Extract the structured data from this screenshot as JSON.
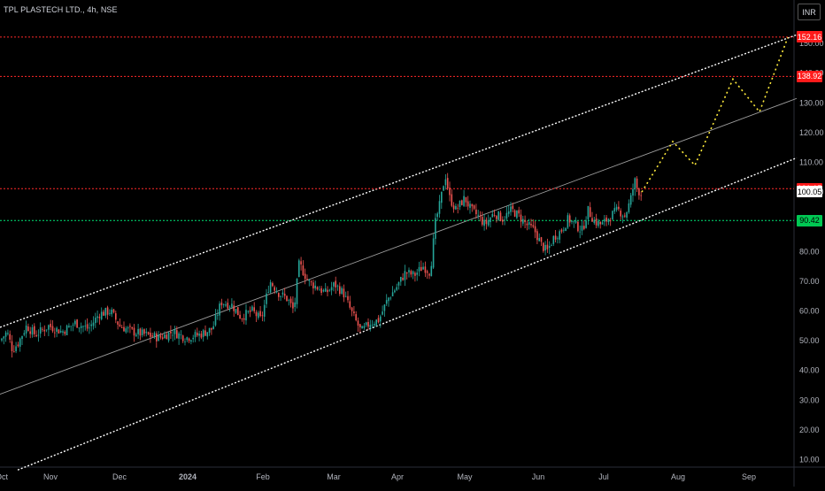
{
  "header": {
    "title": "TPL PLASTECH LTD., 4h, NSE",
    "currency_label": "INR"
  },
  "colors": {
    "background": "#000000",
    "up_candle": "#26a69a",
    "down_candle": "#ef5350",
    "resistance_line": "#ff2a2a",
    "support_line": "#00e676",
    "channel_line": "#ffffff",
    "mid_line": "#9e9e9e",
    "projection": "#ffeb3b",
    "current_price_badge": "#ffffff"
  },
  "chart_data": {
    "type": "candlestick",
    "symbol": "TPL PLASTECH LTD.",
    "interval": "4h",
    "exchange": "NSE",
    "currency": "INR",
    "x_ticks": [
      "Oct",
      "Nov",
      "Dec",
      "2024",
      "Feb",
      "Mar",
      "Apr",
      "May",
      "Jun",
      "Jul",
      "Aug",
      "Sep"
    ],
    "y_ticks": [
      "10.00",
      "20.00",
      "30.00",
      "40.00",
      "50.00",
      "60.00",
      "70.00",
      "80.00",
      "90.00",
      "100.00",
      "110.00",
      "120.00",
      "130.00",
      "140.00",
      "150.00"
    ],
    "y_range": [
      8,
      158
    ],
    "horizontal_levels": [
      {
        "value": 152.16,
        "label": "152.16",
        "color": "#ff2a2a",
        "style": "dotted"
      },
      {
        "value": 138.92,
        "label": "138.92",
        "color": "#ff2a2a",
        "style": "dotted"
      },
      {
        "value": 101.15,
        "label": "101.15",
        "color": "#ff2a2a",
        "style": "dotted"
      },
      {
        "value": 90.42,
        "label": "90.42",
        "color": "#00e676",
        "style": "dotted"
      }
    ],
    "current_price": {
      "value": 100.05,
      "label": "100.05"
    },
    "price_path": [
      [
        0,
        50
      ],
      [
        8,
        53
      ],
      [
        14,
        47
      ],
      [
        20,
        49
      ],
      [
        30,
        55
      ],
      [
        40,
        52
      ],
      [
        55,
        55
      ],
      [
        70,
        53
      ],
      [
        85,
        56
      ],
      [
        100,
        54
      ],
      [
        112,
        59
      ],
      [
        125,
        60
      ],
      [
        135,
        55
      ],
      [
        150,
        53
      ],
      [
        165,
        52
      ],
      [
        180,
        51
      ],
      [
        195,
        53
      ],
      [
        210,
        51
      ],
      [
        225,
        52
      ],
      [
        240,
        54
      ],
      [
        250,
        63
      ],
      [
        262,
        62
      ],
      [
        272,
        58
      ],
      [
        285,
        60
      ],
      [
        295,
        57
      ],
      [
        305,
        70
      ],
      [
        315,
        66
      ],
      [
        325,
        64
      ],
      [
        332,
        60
      ],
      [
        338,
        76
      ],
      [
        348,
        70
      ],
      [
        358,
        68
      ],
      [
        368,
        66
      ],
      [
        378,
        69
      ],
      [
        388,
        66
      ],
      [
        398,
        59
      ],
      [
        408,
        53
      ],
      [
        418,
        56
      ],
      [
        428,
        57
      ],
      [
        438,
        64
      ],
      [
        448,
        68
      ],
      [
        458,
        73
      ],
      [
        468,
        72
      ],
      [
        478,
        75
      ],
      [
        486,
        73
      ],
      [
        492,
        90
      ],
      [
        497,
        96
      ],
      [
        503,
        106
      ],
      [
        508,
        98
      ],
      [
        515,
        94
      ],
      [
        525,
        98
      ],
      [
        532,
        94
      ],
      [
        540,
        92
      ],
      [
        548,
        89
      ],
      [
        558,
        93
      ],
      [
        568,
        91
      ],
      [
        578,
        94
      ],
      [
        586,
        92
      ],
      [
        595,
        89
      ],
      [
        604,
        87
      ],
      [
        612,
        82
      ],
      [
        618,
        80
      ],
      [
        626,
        85
      ],
      [
        634,
        87
      ],
      [
        642,
        91
      ],
      [
        650,
        89
      ],
      [
        658,
        87
      ],
      [
        664,
        94
      ],
      [
        672,
        90
      ],
      [
        680,
        89
      ],
      [
        690,
        92
      ],
      [
        698,
        94
      ],
      [
        706,
        92
      ],
      [
        712,
        97
      ],
      [
        717,
        104
      ],
      [
        720,
        101
      ],
      [
        725,
        99
      ]
    ],
    "projection_path": [
      [
        725,
        100
      ],
      [
        760,
        117
      ],
      [
        785,
        109
      ],
      [
        828,
        138
      ],
      [
        858,
        127
      ],
      [
        890,
        152
      ]
    ],
    "channel": {
      "upper": {
        "x1": 0,
        "v1": 54.5,
        "x2": 900,
        "v2": 152.9
      },
      "middle": {
        "x1": 0,
        "v1": 32,
        "x2": 900,
        "v2": 131.5
      },
      "lower": {
        "x1": 20,
        "v1": 6.5,
        "x2": 900,
        "v2": 111.5
      }
    }
  }
}
